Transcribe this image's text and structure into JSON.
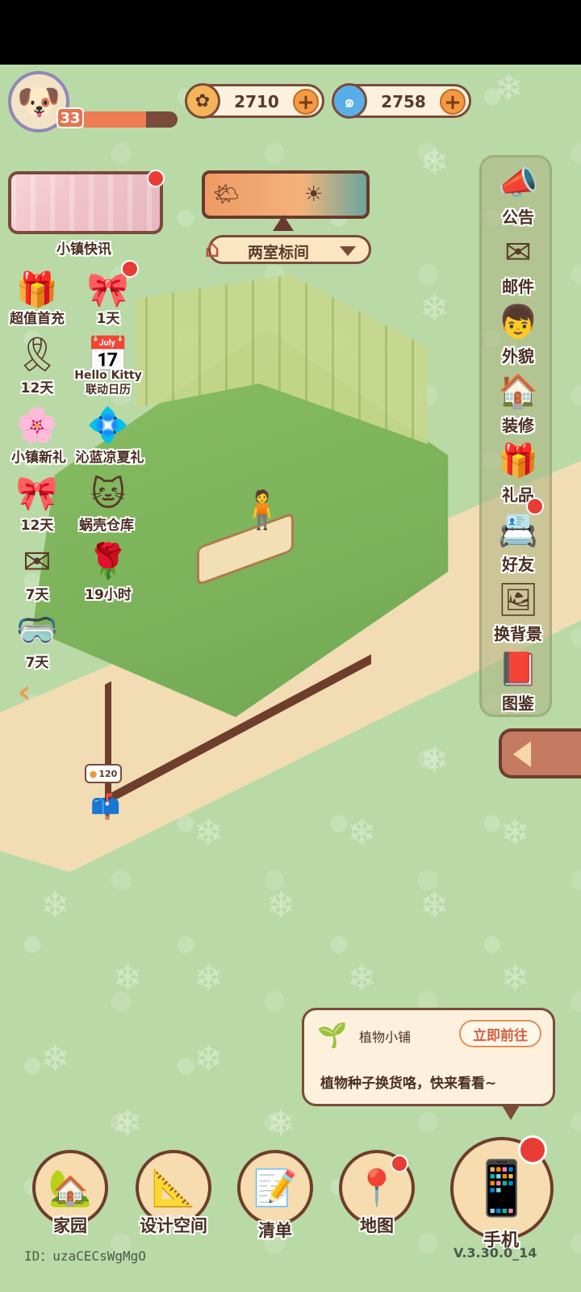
{
  "player": {
    "avatar_icon": "puppy-avatar-icon",
    "level": "33",
    "xp_fraction": 0.68
  },
  "currencies": [
    {
      "icon": "coin-icon",
      "value": "2710",
      "color": "#f2a54a"
    },
    {
      "icon": "swirl-gem-icon",
      "value": "2758",
      "color": "#4aa0e0"
    }
  ],
  "news": {
    "label": "小镇快讯"
  },
  "room": {
    "name": "两室标间"
  },
  "activities": [
    {
      "icon": "gift-flower-icon",
      "label": "超值首充"
    },
    {
      "icon": "gift-box-icon",
      "label": "1天"
    },
    {
      "icon": "gold-ribbon-icon",
      "label": "12天"
    },
    {
      "icon": "calendar-icon",
      "label": "Hello Kitty\n联动日历"
    },
    {
      "icon": "pink-flower-gift-icon",
      "label": "小镇新礼"
    },
    {
      "icon": "blue-flower-icon",
      "label": "沁蓝凉夏礼"
    },
    {
      "icon": "pink-bow-icon",
      "label": "12天"
    },
    {
      "icon": "cat-warehouse-icon",
      "label": "蜗壳仓库"
    },
    {
      "icon": "letter-icon",
      "label": "7天"
    },
    {
      "icon": "blue-rose-box-icon",
      "label": "19小时"
    },
    {
      "icon": "goggles-icon",
      "label": "7天"
    }
  ],
  "right_menu": [
    {
      "icon": "megaphone-icon",
      "label": "公告"
    },
    {
      "icon": "mail-icon",
      "label": "邮件"
    },
    {
      "icon": "character-face-icon",
      "label": "外貌"
    },
    {
      "icon": "house-wrench-icon",
      "label": "装修"
    },
    {
      "icon": "gift-icon",
      "label": "礼品"
    },
    {
      "icon": "contacts-icon",
      "label": "好友"
    },
    {
      "icon": "background-card-icon",
      "label": "换背景"
    },
    {
      "icon": "book-icon",
      "label": "图鉴"
    }
  ],
  "mailbox": {
    "price": "120"
  },
  "popup": {
    "icon": "plant-sprout-icon",
    "title": "植物小铺",
    "go_label": "立即前往",
    "message": "植物种子换货咯，快来看看~"
  },
  "bottom_nav": [
    {
      "icon": "home-icon",
      "label": "家园"
    },
    {
      "icon": "design-ruler-icon",
      "label": "设计空间"
    },
    {
      "icon": "checklist-icon",
      "label": "清单"
    },
    {
      "icon": "map-pin-icon",
      "label": "地图"
    },
    {
      "icon": "phone-icon",
      "label": "手机"
    }
  ],
  "footer": {
    "id_text": "ID：uzaCECsWgMgO",
    "version": "V.3.30.0_14"
  },
  "colors": {
    "background": "#b9d9a7",
    "brown_outline": "#7a4a3a",
    "notification_red": "#e83d36",
    "accent_orange": "#f29a44"
  }
}
